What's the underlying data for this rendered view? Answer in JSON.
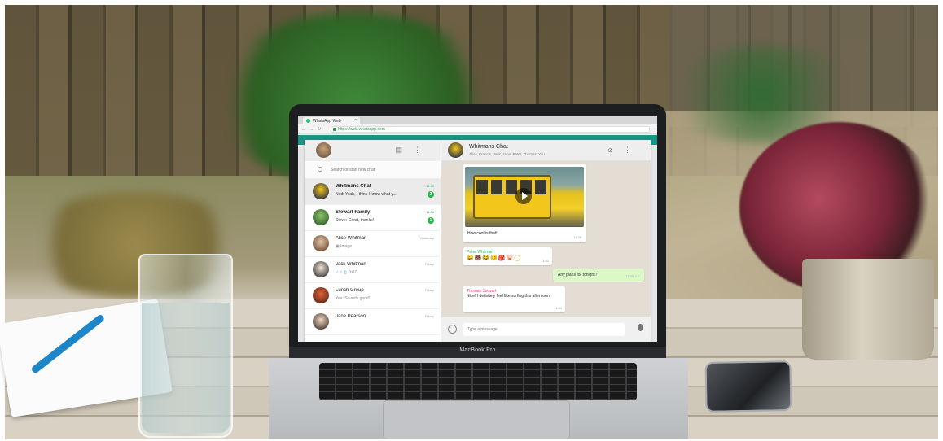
{
  "browser": {
    "tab_title": "WhatsApp Web",
    "tab_close": "×",
    "url": "https://web.whatsapp.com"
  },
  "sidebar": {
    "search_placeholder": "Search or start new chat",
    "chats": [
      {
        "name": "Whitmans Chat",
        "preview": "Ned: Yeah, I think I know what y...",
        "time": "11:45",
        "unread": "2"
      },
      {
        "name": "Stewart Family",
        "preview": "Steve: Great, thanks!",
        "time": "11:06",
        "unread": "1"
      },
      {
        "name": "Alice Whitman",
        "preview": "Image",
        "time": "Yesterday"
      },
      {
        "name": "Jack Whitman",
        "preview": "0:07",
        "time": "Friday"
      },
      {
        "name": "Lunch Group",
        "preview": "You: Sounds good!",
        "time": "Friday"
      },
      {
        "name": "Jane Pearson",
        "preview": "",
        "time": "Friday"
      }
    ]
  },
  "conversation": {
    "title": "Whitmans Chat",
    "members": "Alice, Francis, Jack, Jane, Peter, Thomas, You",
    "messages": {
      "video_caption": "How cool is that!",
      "video_time": "11:36",
      "peter_sender": "Peter Whitman",
      "peter_emojis": "😀🐻😂😊🎒🐷◯",
      "peter_time": "11:42",
      "outgoing_text": "Any plans for tonight?",
      "outgoing_time": "11:43 ✓✓",
      "thomas_sender": "Thomas Stewart",
      "thomas_text": "Nice! I definitely feel like surfing this afternoon",
      "thomas_time": "11:44"
    },
    "compose_placeholder": "Type a message"
  },
  "laptop": {
    "brand": "MacBook Pro"
  }
}
